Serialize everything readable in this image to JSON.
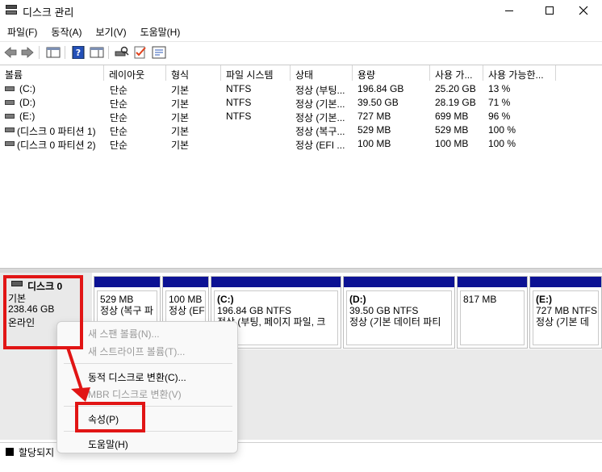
{
  "window": {
    "title": "디스크 관리",
    "controls": {
      "minimize": "minimize",
      "maximize": "maximize",
      "close": "close"
    }
  },
  "menu": [
    "파일(F)",
    "동작(A)",
    "보기(V)",
    "도움말(H)"
  ],
  "toolbar": {
    "icons": [
      "back-arrow-icon",
      "forward-arrow-icon",
      "console-tree-icon",
      "help-icon",
      "properties-pane-icon",
      "rescan-disks-icon",
      "check-icon",
      "properties-icon"
    ]
  },
  "volume_list": {
    "columns": [
      "볼륨",
      "레이아웃",
      "형식",
      "파일 시스템",
      "상태",
      "용량",
      "사용 가...",
      "사용 가능한..."
    ],
    "rows": [
      [
        "(C:)",
        "단순",
        "기본",
        "NTFS",
        "정상 (부팅...",
        "196.84 GB",
        "25.20 GB",
        "13 %"
      ],
      [
        "(D:)",
        "단순",
        "기본",
        "NTFS",
        "정상 (기본...",
        "39.50 GB",
        "28.19 GB",
        "71 %"
      ],
      [
        "(E:)",
        "단순",
        "기본",
        "NTFS",
        "정상 (기본...",
        "727 MB",
        "699 MB",
        "96 %"
      ],
      [
        "(디스크 0 파티션 1)",
        "단순",
        "기본",
        "",
        "정상 (복구...",
        "529 MB",
        "529 MB",
        "100 %"
      ],
      [
        "(디스크 0 파티션 2)",
        "단순",
        "기본",
        "",
        "정상 (EFI ...",
        "100 MB",
        "100 MB",
        "100 %"
      ]
    ]
  },
  "disk": {
    "name": "디스크 0",
    "type": "기본",
    "size": "238.46 GB",
    "status": "온라인",
    "partitions": [
      {
        "label": "",
        "line1": "529 MB",
        "line2": "정상 (복구 파",
        "bold_label": false
      },
      {
        "label": "",
        "line1": "100 MB",
        "line2": "정상 (EF",
        "bold_label": false
      },
      {
        "label": "(C:)",
        "line1": "196.84 GB NTFS",
        "line2": "정상 (부팅, 페이지 파일, 크",
        "bold_label": true
      },
      {
        "label": "(D:)",
        "line1": "39.50 GB NTFS",
        "line2": "정상 (기본 데이터 파티",
        "bold_label": true
      },
      {
        "label": "",
        "line1": "817 MB",
        "line2": "",
        "bold_label": false
      },
      {
        "label": "(E:)",
        "line1": "727 MB NTFS",
        "line2": "정상 (기본 데",
        "bold_label": true
      }
    ]
  },
  "legend": {
    "unallocated": "할당되지"
  },
  "context_menu": {
    "new_spanned": "새 스팬 볼륨(N)...",
    "new_striped": "새 스트라이프 볼륨(T)...",
    "convert_dynamic": "동적 디스크로 변환(C)...",
    "convert_mbr": "MBR 디스크로 변환(V)",
    "properties": "속성(P)",
    "help": "도움말(H)"
  },
  "colors": {
    "partition_bar": "#0c1294",
    "annotation": "#e11515"
  }
}
